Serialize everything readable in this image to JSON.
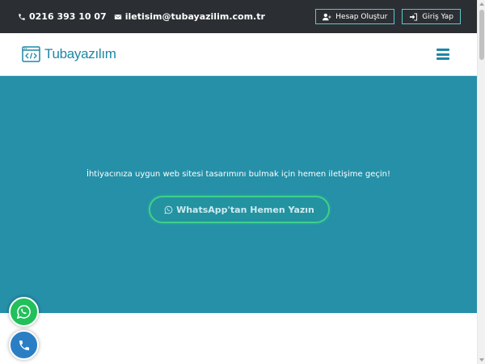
{
  "topbar": {
    "phone": "0216 393 10 07",
    "email": "iletisim@tubayazilim.com.tr",
    "register_label": "Hesap Oluştur",
    "login_label": "Giriş Yap"
  },
  "navbar": {
    "logo_text": "Tubayazılım",
    "logo_icon": "code-icon",
    "menu_icon": "hamburger-menu-icon"
  },
  "hero": {
    "text": "İhtiyacınıza uygun web sitesi tasarımını bulmak için hemen iletişime geçin!",
    "cta_label": "WhatsApp'tan Hemen Yazın"
  },
  "floating": {
    "whatsapp_icon": "whatsapp-icon",
    "phone_icon": "phone-icon"
  },
  "colors": {
    "topbar_bg": "#2b2f33",
    "brand": "#1e87a5",
    "hero_bg": "#2590a8",
    "whatsapp_green": "#21c05b",
    "phone_blue": "#2a7fc4"
  }
}
